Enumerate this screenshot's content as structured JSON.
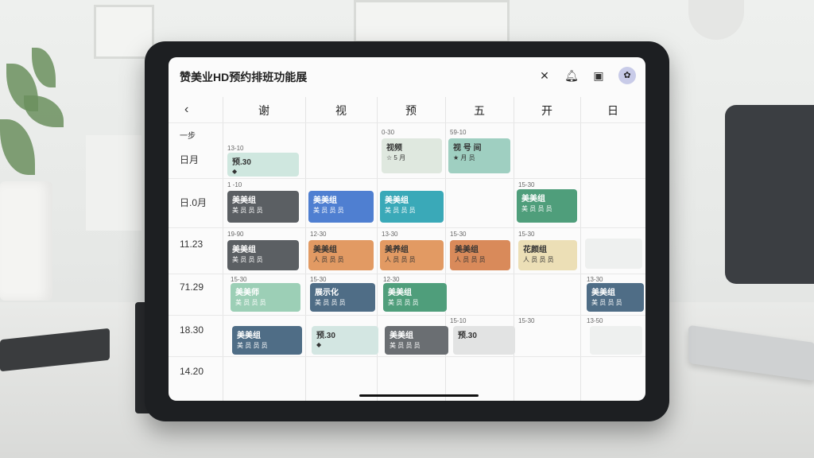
{
  "app": {
    "title": "赞美业HD预约排班功能展"
  },
  "header_icons": [
    "close-icon",
    "bell-icon",
    "calendar-icon",
    "avatar"
  ],
  "avatar_glyph": "✿",
  "calendar": {
    "back_glyph": "‹",
    "days": [
      "谢",
      "视",
      "预",
      "五",
      "开",
      "日"
    ],
    "row_labels": [
      "一步",
      "日月",
      "日.0月",
      "11.23",
      "71.29",
      "18.30",
      "14.20"
    ]
  },
  "times": {
    "r1c3": "0-30",
    "r1c4": "59-10",
    "r2c1": "13-10",
    "r3c1": "1 -10",
    "r3c5": "15-30",
    "r4c1": "19-90",
    "r4c2": "12-30",
    "r4c3": "13-30",
    "r4c4": "15-30",
    "r4c5": "15-30",
    "r5c1": "15-30",
    "r5c2": "15-30",
    "r5c3": "12-30",
    "r5c6": "13-30",
    "r6c4": "15-10",
    "r6c5": "15-30",
    "r6c6": "13-50"
  },
  "cards": [
    {
      "id": "c1",
      "title": "视频",
      "sub": "☆ 5 月",
      "color": "#dfe8df"
    },
    {
      "id": "c2",
      "title": "视 号 间",
      "sub": "★ 月 员",
      "color": "#9fcfc1"
    },
    {
      "id": "c3",
      "title": "预.30",
      "sub": "◆",
      "color": "#cfe7df"
    },
    {
      "id": "c4",
      "title": "美美组",
      "sub": "美 员 员 员",
      "color": "#5b5f63"
    },
    {
      "id": "c5",
      "title": "美美组",
      "sub": "美 员 员 员",
      "color": "#4f7fd1"
    },
    {
      "id": "c6",
      "title": "美美组",
      "sub": "美 员 员 员",
      "color": "#3aa9b8"
    },
    {
      "id": "c7",
      "title": "美美组",
      "sub": "美 员 员 员",
      "color": "#4f9e7b"
    },
    {
      "id": "c8",
      "title": "美美组",
      "sub": "美 员 员 员",
      "color": "#5b5f63"
    },
    {
      "id": "c9",
      "title": "美美组",
      "sub": "人 员 员 员",
      "color": "#e29a63"
    },
    {
      "id": "c10",
      "title": "美养组",
      "sub": "人 员 员 员",
      "color": "#e29a63"
    },
    {
      "id": "c11",
      "title": "美美组",
      "sub": "人 员 员 员",
      "color": "#d98a5a"
    },
    {
      "id": "c12",
      "title": "花颜组",
      "sub": "人 员 员 员",
      "color": "#ecdfb6"
    },
    {
      "id": "c13",
      "title": "美美师",
      "sub": "美 员 员 员",
      "color": "#9ccfb6"
    },
    {
      "id": "c14",
      "title": "展示化",
      "sub": "美 员 员 员",
      "color": "#4f6d86"
    },
    {
      "id": "c15",
      "title": "美美组",
      "sub": "美 员 员 员",
      "color": "#4f9e7b"
    },
    {
      "id": "c16",
      "title": "美美组",
      "sub": "美 员 员 员",
      "color": "#4f6d86"
    },
    {
      "id": "c17",
      "title": "美美组",
      "sub": "美 员 员 员",
      "color": "#4f6d86"
    },
    {
      "id": "c18",
      "title": "预.30",
      "sub": "◆",
      "color": "#d3e6e2"
    },
    {
      "id": "c19",
      "title": "美美组",
      "sub": "美 员 员 员",
      "color": "#6a6e72"
    },
    {
      "id": "c20",
      "title": "预.30",
      "sub": "",
      "color": "#e2e3e3"
    },
    {
      "id": "c21",
      "title": "",
      "sub": "",
      "color": "#eef0ef"
    },
    {
      "id": "c22",
      "title": "",
      "sub": "",
      "color": "#eef0ef"
    }
  ]
}
